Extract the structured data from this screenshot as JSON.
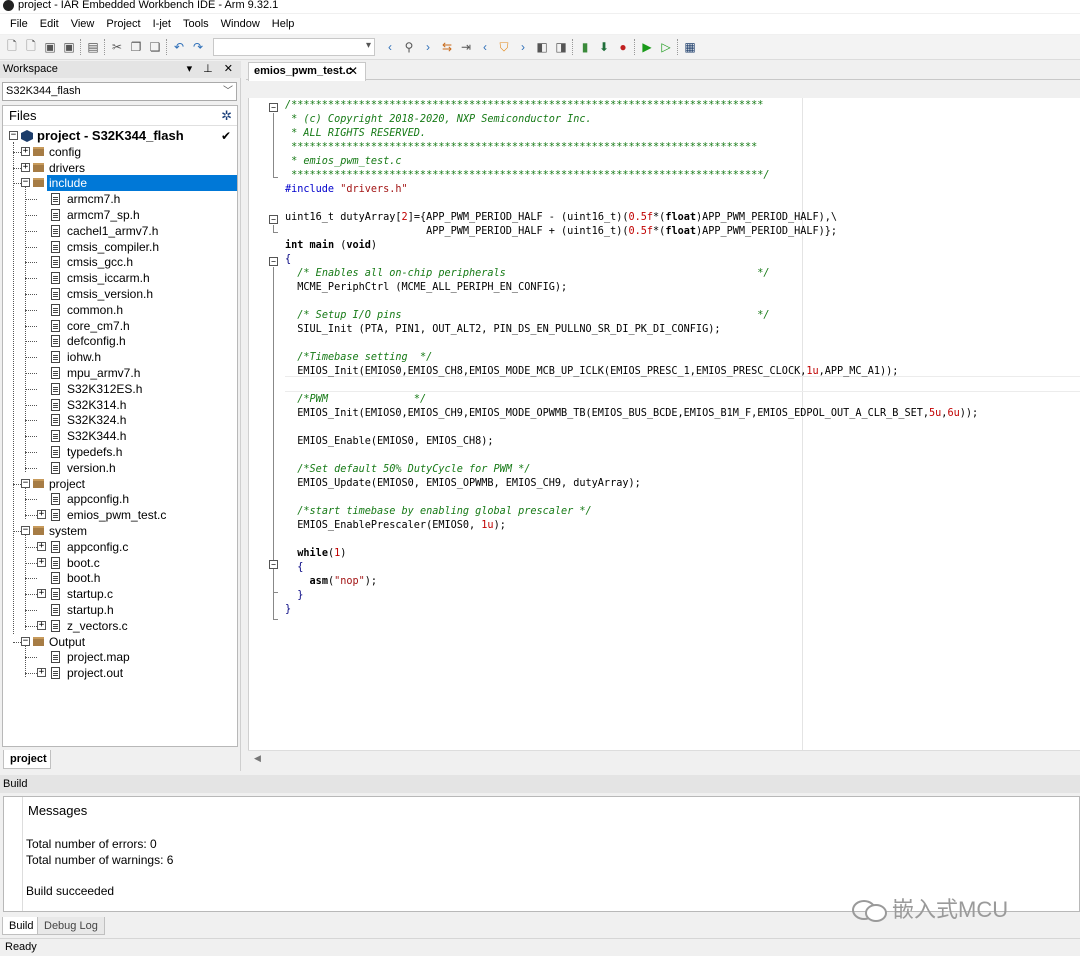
{
  "window": {
    "title": "project - IAR Embedded Workbench IDE - Arm 9.32.1"
  },
  "menu": [
    "File",
    "Edit",
    "View",
    "Project",
    "I-jet",
    "Tools",
    "Window",
    "Help"
  ],
  "workspace": {
    "header": "Workspace",
    "config_select": "S32K344_flash",
    "files_label": "Files",
    "tab": "project",
    "tree": [
      {
        "label": "project - S32K344_flash",
        "level": 0,
        "kind": "project",
        "expander": "⊟",
        "checked": true
      },
      {
        "label": "config",
        "level": 1,
        "kind": "folder",
        "expander": "⊞"
      },
      {
        "label": "drivers",
        "level": 1,
        "kind": "folder",
        "expander": "⊞"
      },
      {
        "label": "include",
        "level": 1,
        "kind": "folder",
        "expander": "⊟",
        "selected": true
      },
      {
        "label": "armcm7.h",
        "level": 2,
        "kind": "file"
      },
      {
        "label": "armcm7_sp.h",
        "level": 2,
        "kind": "file"
      },
      {
        "label": "cachel1_armv7.h",
        "level": 2,
        "kind": "file"
      },
      {
        "label": "cmsis_compiler.h",
        "level": 2,
        "kind": "file"
      },
      {
        "label": "cmsis_gcc.h",
        "level": 2,
        "kind": "file"
      },
      {
        "label": "cmsis_iccarm.h",
        "level": 2,
        "kind": "file"
      },
      {
        "label": "cmsis_version.h",
        "level": 2,
        "kind": "file"
      },
      {
        "label": "common.h",
        "level": 2,
        "kind": "file"
      },
      {
        "label": "core_cm7.h",
        "level": 2,
        "kind": "file"
      },
      {
        "label": "defconfig.h",
        "level": 2,
        "kind": "file"
      },
      {
        "label": "iohw.h",
        "level": 2,
        "kind": "file"
      },
      {
        "label": "mpu_armv7.h",
        "level": 2,
        "kind": "file"
      },
      {
        "label": "S32K312ES.h",
        "level": 2,
        "kind": "file"
      },
      {
        "label": "S32K314.h",
        "level": 2,
        "kind": "file"
      },
      {
        "label": "S32K324.h",
        "level": 2,
        "kind": "file"
      },
      {
        "label": "S32K344.h",
        "level": 2,
        "kind": "file"
      },
      {
        "label": "typedefs.h",
        "level": 2,
        "kind": "file"
      },
      {
        "label": "version.h",
        "level": 2,
        "kind": "file"
      },
      {
        "label": "project",
        "level": 1,
        "kind": "folder",
        "expander": "⊟"
      },
      {
        "label": "appconfig.h",
        "level": 2,
        "kind": "file"
      },
      {
        "label": "emios_pwm_test.c",
        "level": 2,
        "kind": "file",
        "expander": "⊞"
      },
      {
        "label": "system",
        "level": 1,
        "kind": "folder",
        "expander": "⊟"
      },
      {
        "label": "appconfig.c",
        "level": 2,
        "kind": "file",
        "expander": "⊞"
      },
      {
        "label": "boot.c",
        "level": 2,
        "kind": "file",
        "expander": "⊞"
      },
      {
        "label": "boot.h",
        "level": 2,
        "kind": "file"
      },
      {
        "label": "startup.c",
        "level": 2,
        "kind": "file",
        "expander": "⊞"
      },
      {
        "label": "startup.h",
        "level": 2,
        "kind": "file"
      },
      {
        "label": "z_vectors.c",
        "level": 2,
        "kind": "file",
        "expander": "⊞"
      },
      {
        "label": "Output",
        "level": 1,
        "kind": "folder",
        "expander": "⊟"
      },
      {
        "label": "project.map",
        "level": 2,
        "kind": "file"
      },
      {
        "label": "project.out",
        "level": 2,
        "kind": "file",
        "expander": "⊞"
      }
    ]
  },
  "editor": {
    "tab_label": "emios_pwm_test.c",
    "lines": [
      [
        [
          "cm",
          "/*****************************************************************************"
        ]
      ],
      [
        [
          "cm",
          " * (c) Copyright 2018-2020, NXP Semiconductor Inc."
        ]
      ],
      [
        [
          "cm",
          " * ALL RIGHTS RESERVED."
        ]
      ],
      [
        [
          "cm",
          " ****************************************************************************"
        ]
      ],
      [
        [
          "cm",
          " * emios_pwm_test.c"
        ]
      ],
      [
        [
          "cm",
          " *****************************************************************************/"
        ]
      ],
      [
        [
          "pp",
          "#include "
        ],
        [
          "str",
          "\"drivers.h\""
        ]
      ],
      [
        [
          "t",
          ""
        ]
      ],
      [
        [
          "t",
          "uint16_t dutyArray["
        ],
        [
          "num",
          "2"
        ],
        [
          "t",
          "]={APP_PWM_PERIOD_HALF - (uint16_t)("
        ],
        [
          "num",
          "0.5f"
        ],
        [
          "t",
          "*("
        ],
        [
          "kw",
          "float"
        ],
        [
          "t",
          ")APP_PWM_PERIOD_HALF),\\"
        ]
      ],
      [
        [
          "t",
          "                       APP_PWM_PERIOD_HALF + (uint16_t)("
        ],
        [
          "num",
          "0.5f"
        ],
        [
          "t",
          "*("
        ],
        [
          "kw",
          "float"
        ],
        [
          "t",
          ")APP_PWM_PERIOD_HALF)};"
        ]
      ],
      [
        [
          "kw",
          "int"
        ],
        [
          "t",
          " "
        ],
        [
          "kw",
          "main"
        ],
        [
          "t",
          " ("
        ],
        [
          "kw",
          "void"
        ],
        [
          "t",
          ")"
        ]
      ],
      [
        [
          "bl",
          "{"
        ]
      ],
      [
        [
          "t",
          "  "
        ],
        [
          "cm",
          "/* Enables all on-chip peripherals                                         */"
        ]
      ],
      [
        [
          "t",
          "  MCME_PeriphCtrl (MCME_ALL_PERIPH_EN_CONFIG);"
        ]
      ],
      [
        [
          "t",
          ""
        ]
      ],
      [
        [
          "t",
          "  "
        ],
        [
          "cm",
          "/* Setup I/O pins                                                          */"
        ]
      ],
      [
        [
          "t",
          "  SIUL_Init (PTA, PIN1, OUT_ALT2, PIN_DS_EN_PULLNO_SR_DI_PK_DI_CONFIG);"
        ]
      ],
      [
        [
          "t",
          ""
        ]
      ],
      [
        [
          "t",
          "  "
        ],
        [
          "cm",
          "/*Timebase setting  */"
        ]
      ],
      [
        [
          "t",
          "  EMIOS_Init(EMIOS0,EMIOS_CH8,EMIOS_MODE_MCB_UP_ICLK(EMIOS_PRESC_1,EMIOS_PRESC_CLOCK,"
        ],
        [
          "num",
          "1u"
        ],
        [
          "t",
          ",APP_MC_A1));"
        ]
      ],
      [
        [
          "t",
          ""
        ]
      ],
      [
        [
          "t",
          "  "
        ],
        [
          "cm",
          "/*PWM              */"
        ]
      ],
      [
        [
          "t",
          "  EMIOS_Init(EMIOS0,EMIOS_CH9,EMIOS_MODE_OPWMB_TB(EMIOS_BUS_BCDE,EMIOS_B1M_F,EMIOS_EDPOL_OUT_A_CLR_B_SET,"
        ],
        [
          "num",
          "5u"
        ],
        [
          "t",
          ","
        ],
        [
          "num",
          "6u"
        ],
        [
          "t",
          "));"
        ]
      ],
      [
        [
          "t",
          ""
        ]
      ],
      [
        [
          "t",
          "  EMIOS_Enable(EMIOS0, EMIOS_CH8);"
        ]
      ],
      [
        [
          "t",
          ""
        ]
      ],
      [
        [
          "t",
          "  "
        ],
        [
          "cm",
          "/*Set default 50% DutyCycle for PWM */"
        ]
      ],
      [
        [
          "t",
          "  EMIOS_Update(EMIOS0, EMIOS_OPWMB, EMIOS_CH9, dutyArray);"
        ]
      ],
      [
        [
          "t",
          ""
        ]
      ],
      [
        [
          "t",
          "  "
        ],
        [
          "cm",
          "/*start timebase by enabling global prescaler */"
        ]
      ],
      [
        [
          "t",
          "  EMIOS_EnablePrescaler(EMIOS0, "
        ],
        [
          "num",
          "1u"
        ],
        [
          "t",
          ");"
        ]
      ],
      [
        [
          "t",
          ""
        ]
      ],
      [
        [
          "t",
          "  "
        ],
        [
          "kw",
          "while"
        ],
        [
          "t",
          "("
        ],
        [
          "num",
          "1"
        ],
        [
          "t",
          ")"
        ]
      ],
      [
        [
          "t",
          "  "
        ],
        [
          "bl",
          "{"
        ]
      ],
      [
        [
          "t",
          "    "
        ],
        [
          "kw",
          "asm"
        ],
        [
          "t",
          "("
        ],
        [
          "str",
          "\"nop\""
        ],
        [
          "t",
          ");"
        ]
      ],
      [
        [
          "t",
          "  "
        ],
        [
          "bl",
          "}"
        ]
      ],
      [
        [
          "bl",
          "}"
        ]
      ]
    ]
  },
  "build": {
    "header": "Build",
    "messages_label": "Messages",
    "errors": "Total number of errors: 0",
    "warnings": "Total number of warnings: 6",
    "result": "Build succeeded",
    "tabs": [
      "Build",
      "Debug Log"
    ]
  },
  "status": "Ready",
  "watermark": "嵌入式MCU"
}
